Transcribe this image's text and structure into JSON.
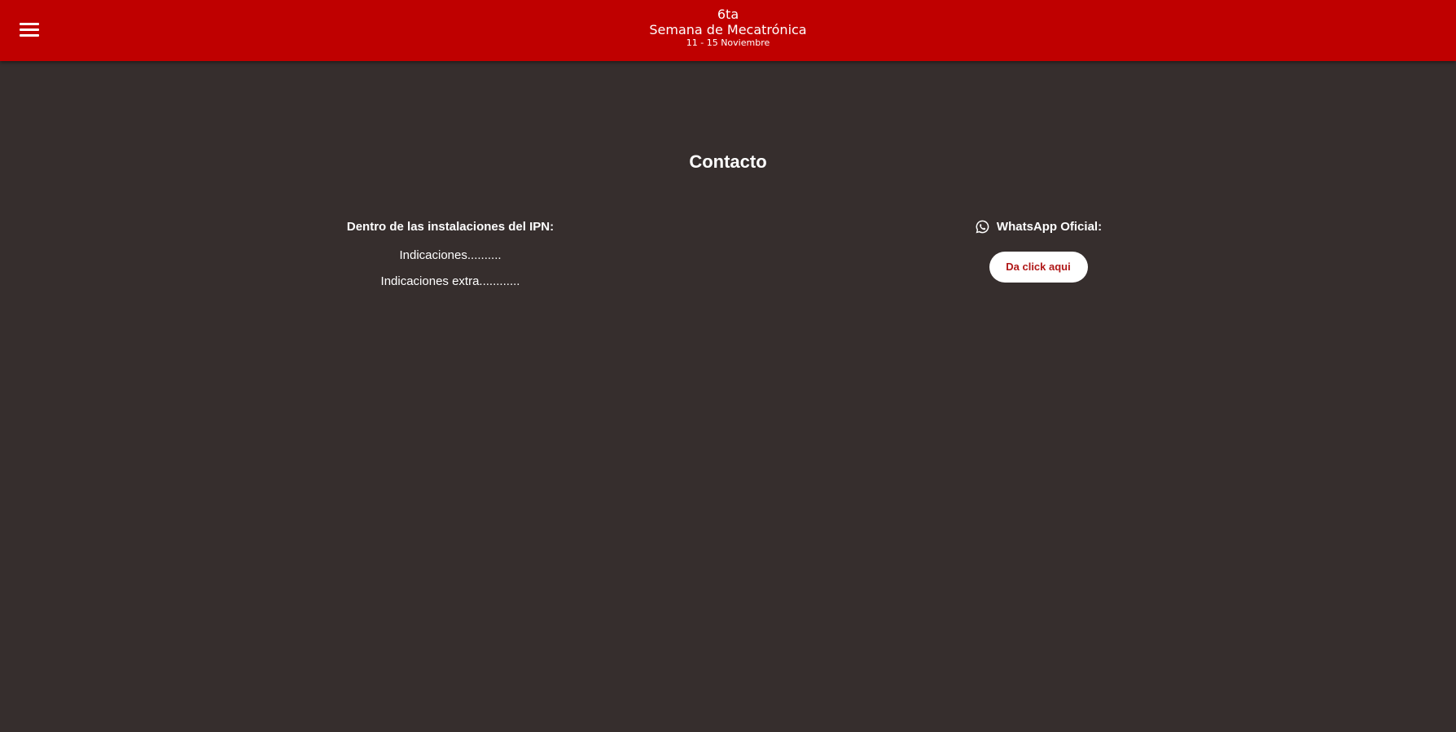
{
  "header": {
    "line1": "6ta",
    "line2": "Semana de Mecatrónica",
    "line3": "11 - 15 Noviembre",
    "menu_icon": "hamburger-icon"
  },
  "main": {
    "title": "Contacto",
    "location": {
      "heading": "Dentro de las instalaciones del IPN:",
      "lines": [
        "Indicaciones..........",
        "Indicaciones extra............"
      ]
    },
    "whatsapp": {
      "icon": "whatsapp-icon",
      "heading": "WhatsApp Oficial:",
      "button_label": "Da click aqui"
    }
  },
  "colors": {
    "header": "#bf0000",
    "background": "#362e2d",
    "button_text": "#b01818"
  }
}
